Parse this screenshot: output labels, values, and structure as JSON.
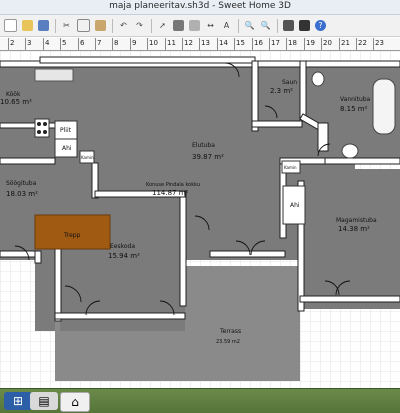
{
  "window": {
    "title": "maja planeeritav.sh3d - Sweet Home 3D"
  },
  "toolbar": {
    "icons": [
      "new-icon",
      "open-icon",
      "save-icon",
      "cut-icon",
      "copy-icon",
      "paste-icon",
      "undo-icon",
      "redo-icon",
      "select-icon",
      "create-walls-icon",
      "create-rooms-icon",
      "dimension-icon",
      "text-icon",
      "zoom-in-icon",
      "zoom-out-icon",
      "camera-icon",
      "photo-icon",
      "help-icon"
    ]
  },
  "ruler": {
    "labels": [
      "2",
      "3",
      "4",
      "5",
      "6",
      "7",
      "8",
      "9",
      "10",
      "11",
      "12",
      "13",
      "14",
      "15",
      "16",
      "17",
      "18",
      "19",
      "20",
      "21",
      "22",
      "23"
    ]
  },
  "rooms": {
    "kook": {
      "name": "Köök",
      "area": "10.65 m²"
    },
    "saun": {
      "name": "Saun",
      "area": "2.3 m²"
    },
    "vannituba": {
      "name": "Vannituba",
      "area": "8.15 m²"
    },
    "elutuba": {
      "name": "Elutuba",
      "area": "39.87 m²"
    },
    "soogituba": {
      "name": "Söögituba",
      "area": "18.03 m²"
    },
    "konuse": {
      "name": "Konuse Pindala kokku",
      "area": "114.87 m²"
    },
    "eeskoda": {
      "name": "Eeskoda",
      "area": "15.94 m²"
    },
    "magamistuba": {
      "name": "Magamistuba",
      "area": "14.38 m²"
    },
    "terrass": {
      "name": "Terrass",
      "area": "23.59 m2"
    }
  },
  "labels": {
    "pliit": "Pliit",
    "ahi_left": "Ahi",
    "ahi_right": "Ahi",
    "kamin_left": "Kamin",
    "kamin_right": "Kamin",
    "trepp": "Trepp"
  },
  "colors": {
    "floor": "#7b7b7b",
    "wall": "#ffffff",
    "wall_stroke": "#222222",
    "stairs": "#a05a12",
    "grid": "#c9c9c9",
    "terrace": "#8a8a8a"
  },
  "taskbar": {
    "items": [
      "start-icon",
      "file-manager-icon",
      "sweet-home-3d-icon"
    ]
  }
}
